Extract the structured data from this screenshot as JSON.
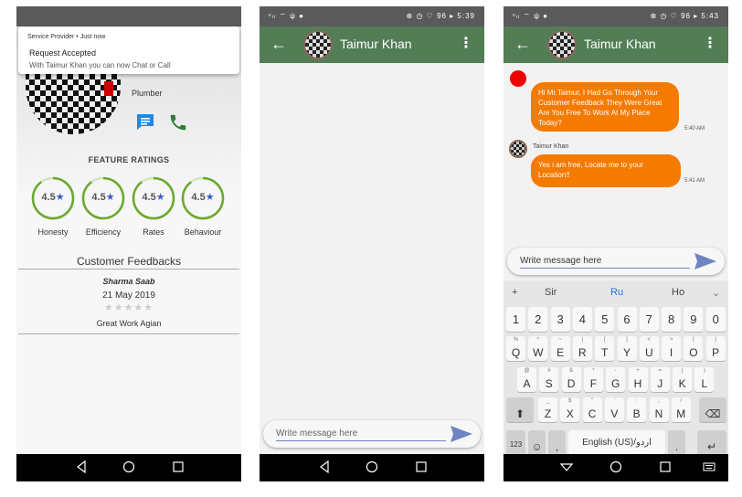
{
  "phone1": {
    "notification": {
      "source": "Service Provider • Just now",
      "title": "Request Accepted",
      "message": "With Taimur Khan you can now Chat or Call"
    },
    "profile": {
      "role": "Plumber"
    },
    "feature_ratings": {
      "title": "FEATURE RATINGS",
      "items": [
        {
          "value": "4.5",
          "label": "Honesty",
          "fill": 0.9
        },
        {
          "value": "4.5",
          "label": "Efficiency",
          "fill": 0.9
        },
        {
          "value": "4.5",
          "label": "Rates",
          "fill": 0.9
        },
        {
          "value": "4.5",
          "label": "Behaviour",
          "fill": 0.9
        }
      ],
      "star_glyph": "★"
    },
    "feedbacks": {
      "title": "Customer Feedbacks",
      "items": [
        {
          "name": "Sharma Saab",
          "date": "21 May 2019",
          "stars": "★★★★★",
          "text": "Great Work Agian",
          "rating": 0
        }
      ]
    }
  },
  "phone2": {
    "status": {
      "left": "ᵛₗₗ ⌔ ψ ●",
      "right": "⊗ ◷ ♡ 96 ▸ 5:39"
    },
    "header": {
      "back": "←",
      "name": "Taimur Khan",
      "menu": "⋮"
    },
    "input": {
      "placeholder": "Write message here"
    }
  },
  "phone3": {
    "status": {
      "left": "ᵛₗₗ ⌔ ψ ●",
      "right": "⊗ ◷ ♡ 96 ▸ 5:43"
    },
    "header": {
      "back": "←",
      "name": "Taimur Khan",
      "menu": "⋮"
    },
    "messages": [
      {
        "text": "Hi Mr.Taimur, I Had Go Through Your Customer Feedback They Were Great Are You Free To Work At My Place Today?",
        "time": "5:40 AM"
      },
      {
        "sender": "Taimur Khan",
        "text": "Yes i am free, Locate me to your Location!!",
        "time": "5:41 AM"
      }
    ],
    "input": {
      "value": "Write message here"
    },
    "keyboard": {
      "suggestions": [
        "+",
        "Sir",
        "Ru",
        "Ho",
        "⌄"
      ],
      "row_numbers": [
        "1",
        "2",
        "3",
        "4",
        "5",
        "6",
        "7",
        "8",
        "9",
        "0"
      ],
      "row1": {
        "keys": [
          "Q",
          "W",
          "E",
          "R",
          "T",
          "Y",
          "U",
          "I",
          "O",
          "P"
        ],
        "sups": [
          "%",
          "^",
          "~",
          "|",
          "[",
          "]",
          "<",
          ">",
          "{",
          "}"
        ]
      },
      "row2": {
        "keys": [
          "A",
          "S",
          "D",
          "F",
          "G",
          "H",
          "J",
          "K",
          "L"
        ],
        "sups": [
          "@",
          "#",
          "&",
          "*",
          "-",
          "+",
          "=",
          "(",
          ")"
        ]
      },
      "row3": {
        "keys": [
          "Z",
          "X",
          "C",
          "V",
          "B",
          "N",
          "M"
        ],
        "sups": [
          "_",
          "$",
          "\"",
          "'",
          ":",
          ";",
          "/"
        ]
      },
      "shift": "⬆",
      "backspace": "⌫",
      "symbols": "123",
      "emoji": "☺",
      "comma": ",",
      "space": "English (US)/اردو",
      "period": ".",
      "enter": "↵"
    }
  },
  "colors": {
    "appbar": "#527d55",
    "bubble": "#f57a00",
    "send_icon": "#6f85c2",
    "rating_ring": "#6aaa2e",
    "star": "#3a5bd0"
  }
}
